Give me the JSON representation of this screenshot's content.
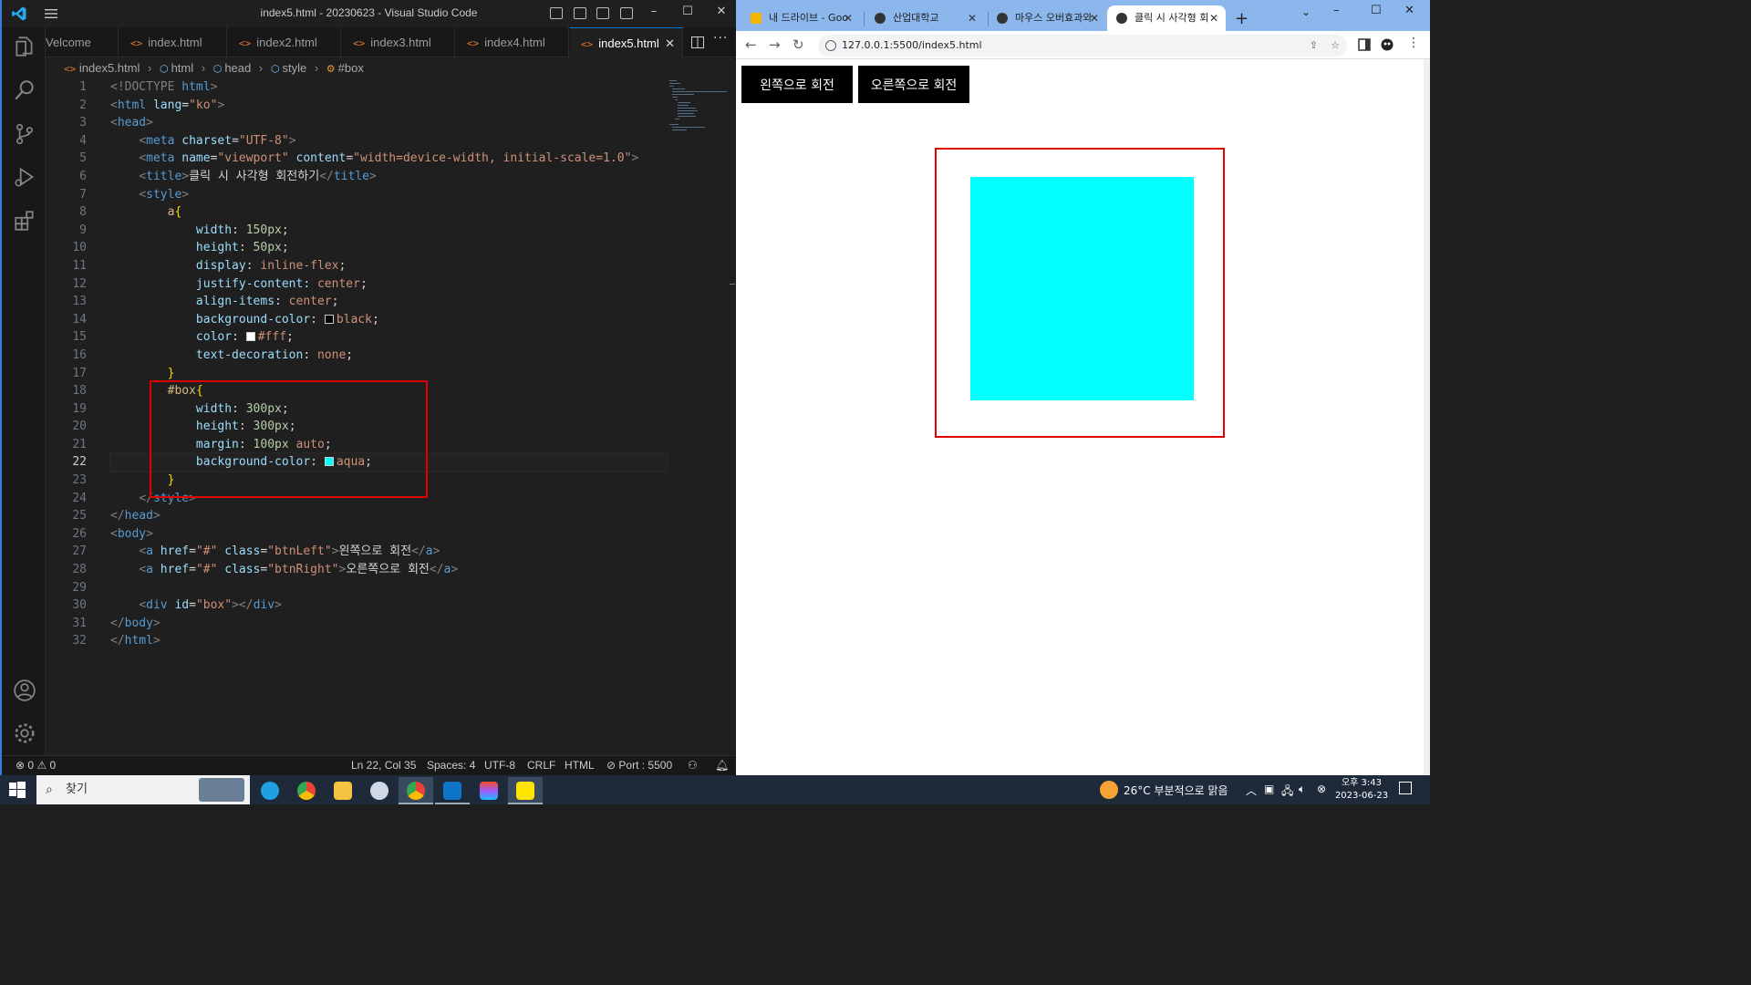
{
  "vscode": {
    "window_title": "index5.html - 20230623 - Visual Studio Code",
    "tabs": [
      {
        "label": "Welcome",
        "display": "Velcome"
      },
      {
        "label": "index.html"
      },
      {
        "label": "index2.html"
      },
      {
        "label": "index3.html"
      },
      {
        "label": "index4.html"
      },
      {
        "label": "index5.html",
        "active": true
      }
    ],
    "breadcrumb": [
      "index5.html",
      "html",
      "head",
      "style",
      "#box"
    ],
    "line_numbers": [
      "1",
      "2",
      "3",
      "4",
      "5",
      "6",
      "7",
      "8",
      "9",
      "10",
      "11",
      "12",
      "13",
      "14",
      "15",
      "16",
      "17",
      "18",
      "19",
      "20",
      "21",
      "22",
      "23",
      "24",
      "25",
      "26",
      "27",
      "28",
      "29",
      "30",
      "31",
      "32"
    ],
    "current_line": "22",
    "code": {
      "l1": [
        "<!DOCTYPE ",
        "html",
        ">"
      ],
      "l2": [
        "<",
        "html",
        " lang",
        "=",
        "\"ko\"",
        ">"
      ],
      "l3": [
        "<",
        "head",
        ">"
      ],
      "l4": [
        "<",
        "meta",
        " charset",
        "=",
        "\"UTF-8\"",
        ">"
      ],
      "l5": [
        "<",
        "meta",
        " name",
        "=",
        "\"viewport\"",
        " content",
        "=",
        "\"width=device-width, initial-scale=1.0\"",
        ">"
      ],
      "l6": [
        "<",
        "title",
        ">",
        "클릭 시 사각형 회전하기",
        "</",
        "title",
        ">"
      ],
      "l7": [
        "<",
        "style",
        ">"
      ],
      "l8": [
        "a",
        "{"
      ],
      "l9": [
        "width",
        ": ",
        "150px",
        ";"
      ],
      "l10": [
        "height",
        ": ",
        "50px",
        ";"
      ],
      "l11": [
        "display",
        ": ",
        "inline-flex",
        ";"
      ],
      "l12": [
        "justify-content",
        ": ",
        "center",
        ";"
      ],
      "l13": [
        "align-items",
        ": ",
        "center",
        ";"
      ],
      "l14": [
        "background-color",
        ": ",
        "black",
        ";"
      ],
      "l15": [
        "color",
        ": ",
        "#fff",
        ";"
      ],
      "l16": [
        "text-decoration",
        ": ",
        "none",
        ";"
      ],
      "l17": [
        "}"
      ],
      "l18": [
        "#box",
        "{"
      ],
      "l19": [
        "width",
        ": ",
        "300px",
        ";"
      ],
      "l20": [
        "height",
        ": ",
        "300px",
        ";"
      ],
      "l21": [
        "margin",
        ": ",
        "100px",
        " auto",
        ";"
      ],
      "l22": [
        "background-color",
        ": ",
        "aqua",
        ";"
      ],
      "l23": [
        "}"
      ],
      "l24": [
        "</",
        "style",
        ">"
      ],
      "l25": [
        "</",
        "head",
        ">"
      ],
      "l26": [
        "<",
        "body",
        ">"
      ],
      "l27": [
        "<",
        "a",
        " href",
        "=",
        "\"#\"",
        " class",
        "=",
        "\"btnLeft\"",
        ">",
        "왼쪽으로 회전",
        "</",
        "a",
        ">"
      ],
      "l28": [
        "<",
        "a",
        " href",
        "=",
        "\"#\"",
        " class",
        "=",
        "\"btnRight\"",
        ">",
        "오른쪽으로 회전",
        "</",
        "a",
        ">"
      ],
      "l29": [],
      "l30": [
        "<",
        "div",
        " id",
        "=",
        "\"box\"",
        "></",
        "div",
        ">"
      ],
      "l31": [
        "</",
        "body",
        ">"
      ],
      "l32": [
        "</",
        "html",
        ">"
      ]
    },
    "status": {
      "errors": "0",
      "warnings": "0",
      "position": "Ln 22, Col 35",
      "spaces": "Spaces: 4",
      "encoding": "UTF-8",
      "eol": "CRLF",
      "language": "HTML",
      "port": "Port : 5500"
    }
  },
  "chrome": {
    "tabs": [
      {
        "label": "내 드라이브 - Goo"
      },
      {
        "label": "산업대학교"
      },
      {
        "label": "마우스 오버효과와"
      },
      {
        "label": "클릭 시 사각형 회",
        "active": true
      }
    ],
    "url": "127.0.0.1:5500/index5.html",
    "page": {
      "btn_left": "왼쪽으로 회전",
      "btn_right": "오른쪽으로 회전",
      "box_color": "#00ffff"
    }
  },
  "taskbar": {
    "search_placeholder": "찾기",
    "weather": "26°C  부분적으로 맑음",
    "time": "오후 3:43",
    "date": "2023-06-23"
  },
  "colors": {
    "vscode_accent": "#0078d4",
    "highlight_red": "#e00000",
    "aqua": "#00ffff",
    "chrome_tabstrip": "#8cb7ec"
  }
}
